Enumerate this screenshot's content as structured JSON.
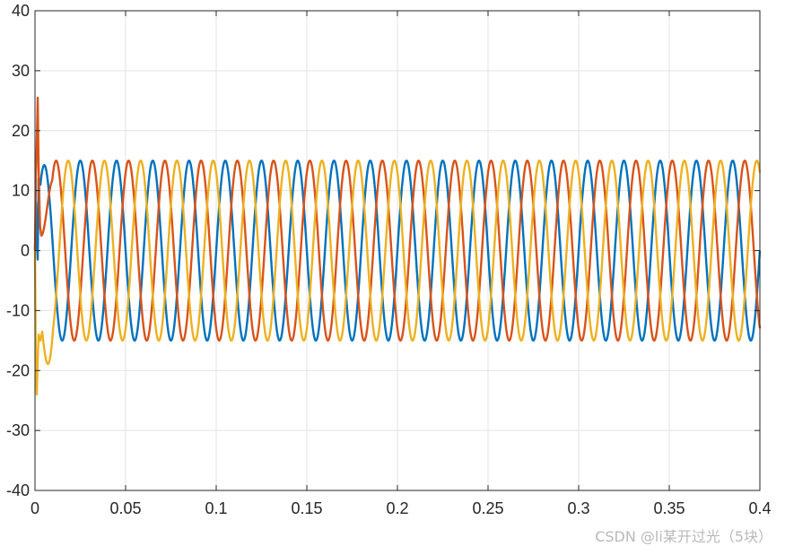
{
  "chart_data": {
    "type": "line",
    "title": "",
    "xlabel": "",
    "ylabel": "",
    "xlim": [
      0,
      0.4
    ],
    "ylim": [
      -40,
      40
    ],
    "x_ticks": [
      "0",
      "0.05",
      "0.1",
      "0.15",
      "0.2",
      "0.25",
      "0.3",
      "0.35",
      "0.4"
    ],
    "y_ticks": [
      "40",
      "30",
      "20",
      "10",
      "0",
      "-10",
      "-20",
      "-30",
      "-40"
    ],
    "grid": true,
    "legend": "none",
    "frequency_hz": 50,
    "series": [
      {
        "color": "#0072bd",
        "amplitude": 15,
        "phase_deg": 0,
        "transient": [
          [
            0,
            0
          ],
          [
            0.0005,
            8
          ],
          [
            0.001,
            2
          ],
          [
            0.0015,
            -1.5
          ],
          [
            0.002,
            12
          ],
          [
            0.003,
            11
          ]
        ]
      },
      {
        "color": "#d95319",
        "amplitude": 15,
        "phase_deg": -120,
        "transient": [
          [
            0,
            0
          ],
          [
            0.0005,
            12
          ],
          [
            0.001,
            18
          ],
          [
            0.0015,
            25.5
          ],
          [
            0.002,
            14
          ],
          [
            0.0028,
            4
          ],
          [
            0.0035,
            2.5
          ]
        ]
      },
      {
        "color": "#edb120",
        "amplitude": 15,
        "phase_deg": 120,
        "transient": [
          [
            0,
            0
          ],
          [
            0.0005,
            -20
          ],
          [
            0.001,
            -24
          ],
          [
            0.0015,
            -18
          ],
          [
            0.002,
            -14
          ],
          [
            0.003,
            -15
          ],
          [
            0.004,
            -13.5
          ]
        ]
      }
    ]
  },
  "watermark": "CSDN @li某开过光（5块）"
}
